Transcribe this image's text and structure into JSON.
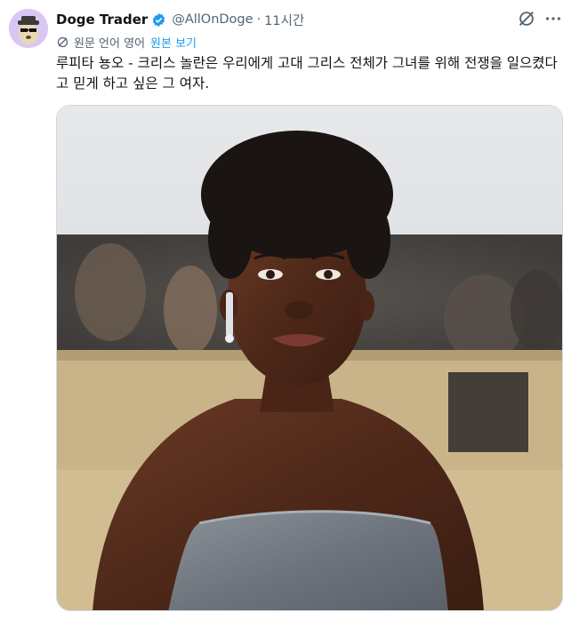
{
  "tweet": {
    "author": {
      "display_name": "Doge Trader",
      "handle": "@AllOnDoge",
      "verified": true,
      "avatar_icon": "doge-avatar-icon"
    },
    "separator": "·",
    "timestamp": "11시간",
    "translation": {
      "label": "원문 언어 영어",
      "show_original": "원본 보기"
    },
    "text": "루피타 뇽오 - 크리스 놀란은 우리에게 고대 그리스 전체가 그녀를 위해 전쟁을 일으켰다고 믿게 하고 싶은 그 여자.",
    "media": {
      "kind": "photo"
    }
  },
  "colors": {
    "accent": "#1d9bf0",
    "secondary_text": "#536471",
    "primary_text": "#0f1419"
  }
}
